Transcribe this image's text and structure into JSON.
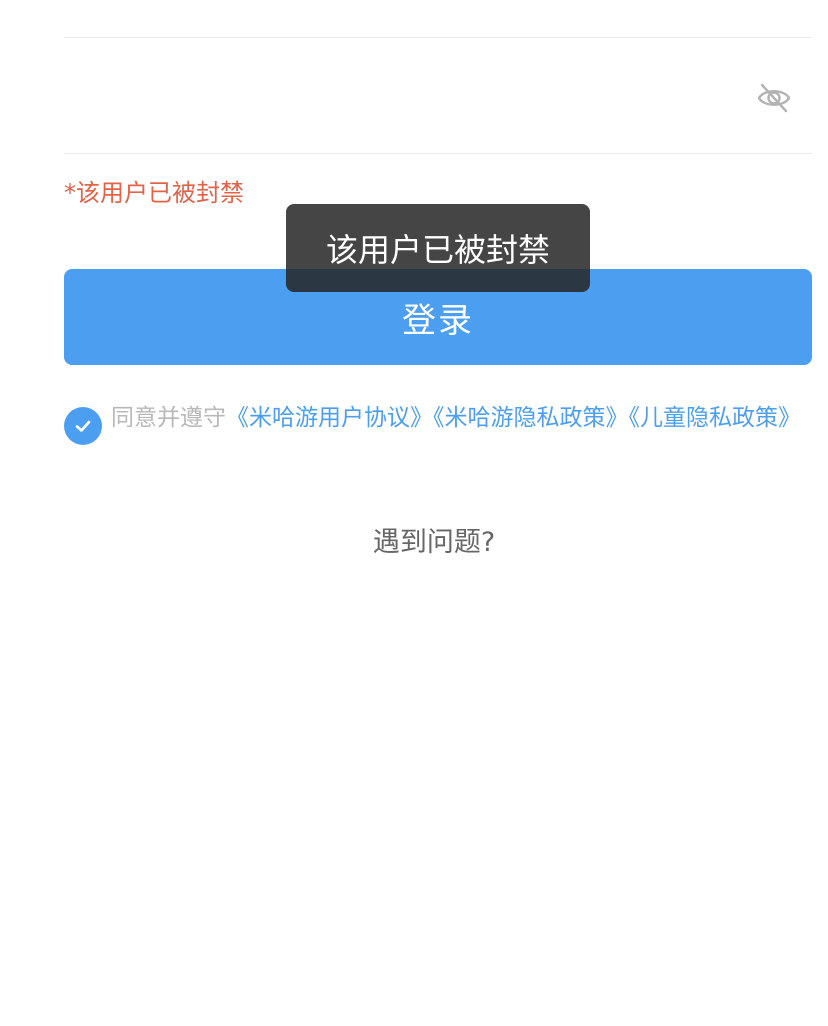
{
  "password_field": {
    "value": "",
    "placeholder": ""
  },
  "error": {
    "message": "*该用户已被封禁"
  },
  "toast": {
    "message": "该用户已被封禁"
  },
  "login_button": {
    "label": "登录"
  },
  "agreement": {
    "checked": true,
    "prefix": "同意并遵守",
    "user_agreement": "《米哈游用户协议》",
    "privacy_policy": "《米哈游隐私政策》",
    "children_privacy": "《儿童隐私政策》"
  },
  "help": {
    "label": "遇到问题?"
  },
  "colors": {
    "accent": "#4c9ff0",
    "error": "#e0634a",
    "toast_bg": "#262626"
  },
  "icons": {
    "password_visibility": "eye-off-icon",
    "checkbox": "checkmark-icon"
  }
}
